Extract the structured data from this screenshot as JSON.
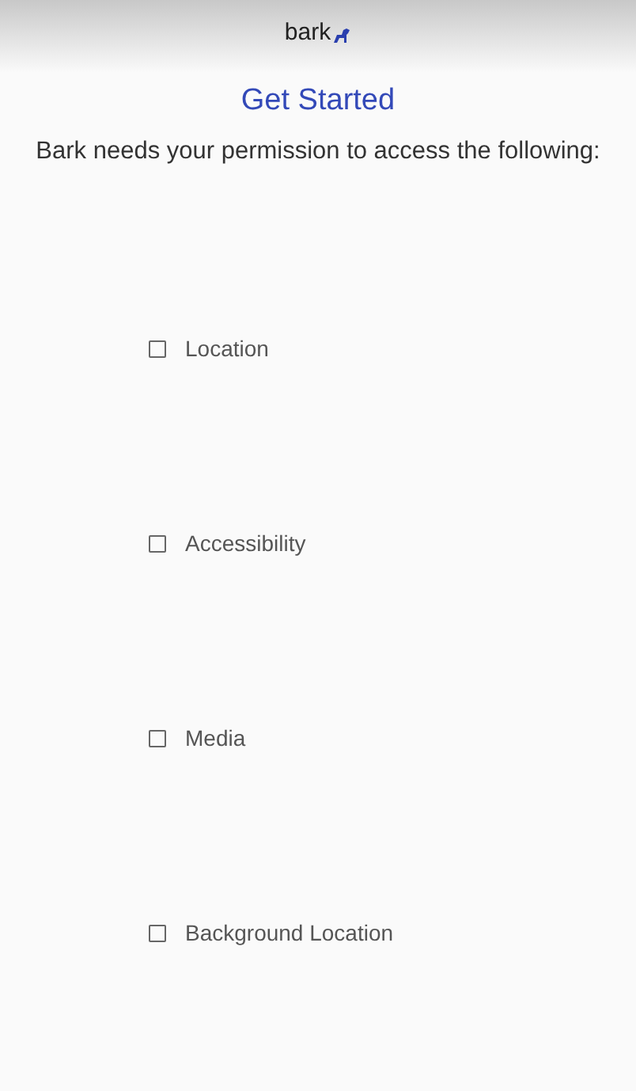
{
  "header": {
    "logo": "bark"
  },
  "title": "Get Started",
  "subtitle": "Bark needs your permission to access the following:",
  "permissions": [
    {
      "label": "Location",
      "checked": false
    },
    {
      "label": "Accessibility",
      "checked": false
    },
    {
      "label": "Media",
      "checked": false
    },
    {
      "label": "Background Location",
      "checked": false
    }
  ]
}
